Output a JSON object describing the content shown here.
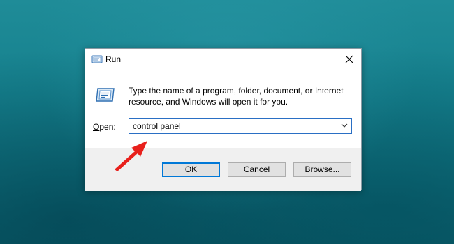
{
  "dialog": {
    "title": "Run",
    "description_line1": "Type the name of a program, folder, document, or Internet",
    "description_line2": "resource, and Windows will open it for you.",
    "open_label": "Open:",
    "input_value": "control panel",
    "buttons": {
      "ok": "OK",
      "cancel": "Cancel",
      "browse": "Browse..."
    }
  },
  "icons": {
    "title": "run-icon",
    "large": "run-icon",
    "close": "close-icon",
    "dropdown": "chevron-down-icon",
    "annotation": "red-arrow-icon"
  },
  "colors": {
    "desktop": "#15808d",
    "focus_border": "#0078d7",
    "annotation_arrow": "#e8201c"
  }
}
